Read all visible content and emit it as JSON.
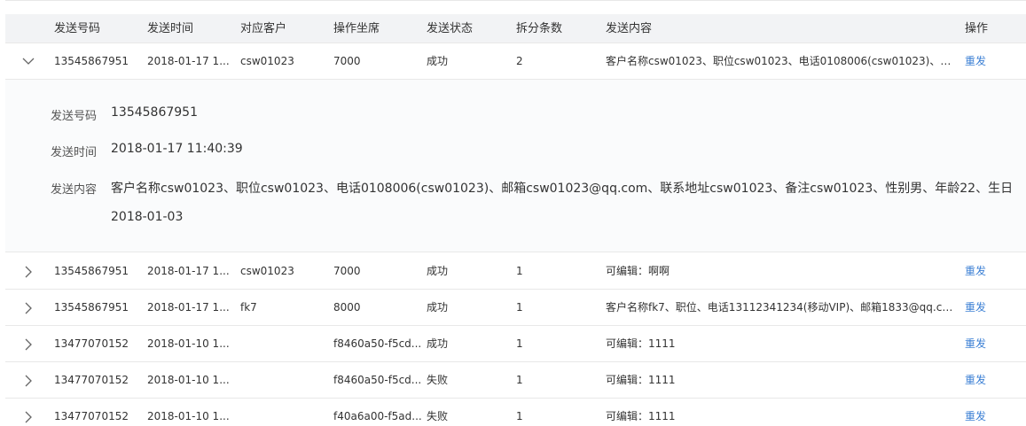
{
  "header": {
    "columns": [
      "发送号码",
      "发送时间",
      "对应客户",
      "操作坐席",
      "发送状态",
      "拆分条数",
      "发送内容",
      "操作"
    ]
  },
  "rows": [
    {
      "phone": "13545867951",
      "time": "2018-01-17 1...",
      "customer": "csw01023",
      "agent": "7000",
      "status": "成功",
      "count": "2",
      "content": "客户名称csw01023、职位csw01023、电话0108006(csw01023)、邮...",
      "action": "重发"
    },
    {
      "phone": "13545867951",
      "time": "2018-01-17 1...",
      "customer": "csw01023",
      "agent": "7000",
      "status": "成功",
      "count": "1",
      "content": "可编辑：啊啊",
      "action": "重发"
    },
    {
      "phone": "13545867951",
      "time": "2018-01-17 1...",
      "customer": "fk7",
      "agent": "8000",
      "status": "成功",
      "count": "1",
      "content": "客户名称fk7、职位、电话13112341234(移动VIP)、邮箱1833@qq.co...",
      "action": "重发"
    },
    {
      "phone": "13477070152",
      "time": "2018-01-10 1...",
      "customer": "",
      "agent": "f8460a50-f5cd...",
      "status": "成功",
      "count": "1",
      "content": "可编辑：1111",
      "action": "重发"
    },
    {
      "phone": "13477070152",
      "time": "2018-01-10 1...",
      "customer": "",
      "agent": "f8460a50-f5cd...",
      "status": "失败",
      "count": "1",
      "content": "可编辑：1111",
      "action": "重发"
    },
    {
      "phone": "13477070152",
      "time": "2018-01-10 1...",
      "customer": "",
      "agent": "f40a6a00-f5ad...",
      "status": "失败",
      "count": "1",
      "content": "可编辑：1111",
      "action": "重发"
    }
  ],
  "detail": {
    "phone_label": "发送号码",
    "phone_value": "13545867951",
    "time_label": "发送时间",
    "time_value": "2018-01-17 11:40:39",
    "content_label": "发送内容",
    "content_line1": "客户名称csw01023、职位csw01023、电话0108006(csw01023)、邮箱csw01023@qq.com、联系地址csw01023、备注csw01023、性别男、年龄22、生日",
    "content_line2": "2018-01-03"
  },
  "colors": {
    "link": "#3b7fd4",
    "header_bg": "#f2f3f5",
    "detail_bg": "#fafbfc",
    "border": "#e8e8e8"
  },
  "icons": {
    "expanded": "chevron-down-icon",
    "collapsed": "chevron-right-icon"
  }
}
